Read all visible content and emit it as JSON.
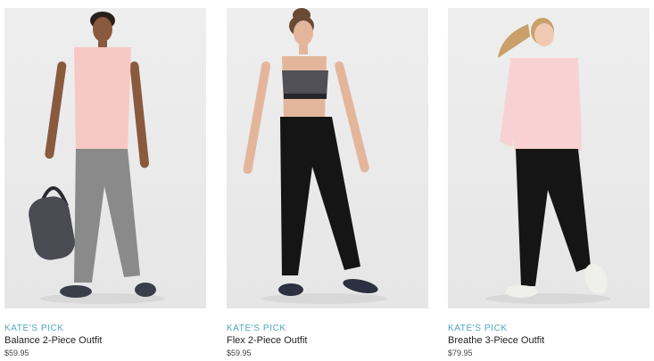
{
  "products": [
    {
      "tag": "KATE'S PICK",
      "name": "Balance 2-Piece Outfit",
      "price": "$59.95",
      "top_color": "#f7c9c4",
      "bottom_color": "#8a8a8a"
    },
    {
      "tag": "KATE'S PICK",
      "name": "Flex 2-Piece Outfit",
      "price": "$59.95",
      "top_color": "#505056",
      "bottom_color": "#151515"
    },
    {
      "tag": "KATE'S PICK",
      "name": "Breathe 3-Piece Outfit",
      "price": "$79.95",
      "top_color": "#f8d2d2",
      "bottom_color": "#151515"
    }
  ],
  "colors": {
    "accent": "#4fa7bd",
    "photo_background": "#eaeaea"
  }
}
